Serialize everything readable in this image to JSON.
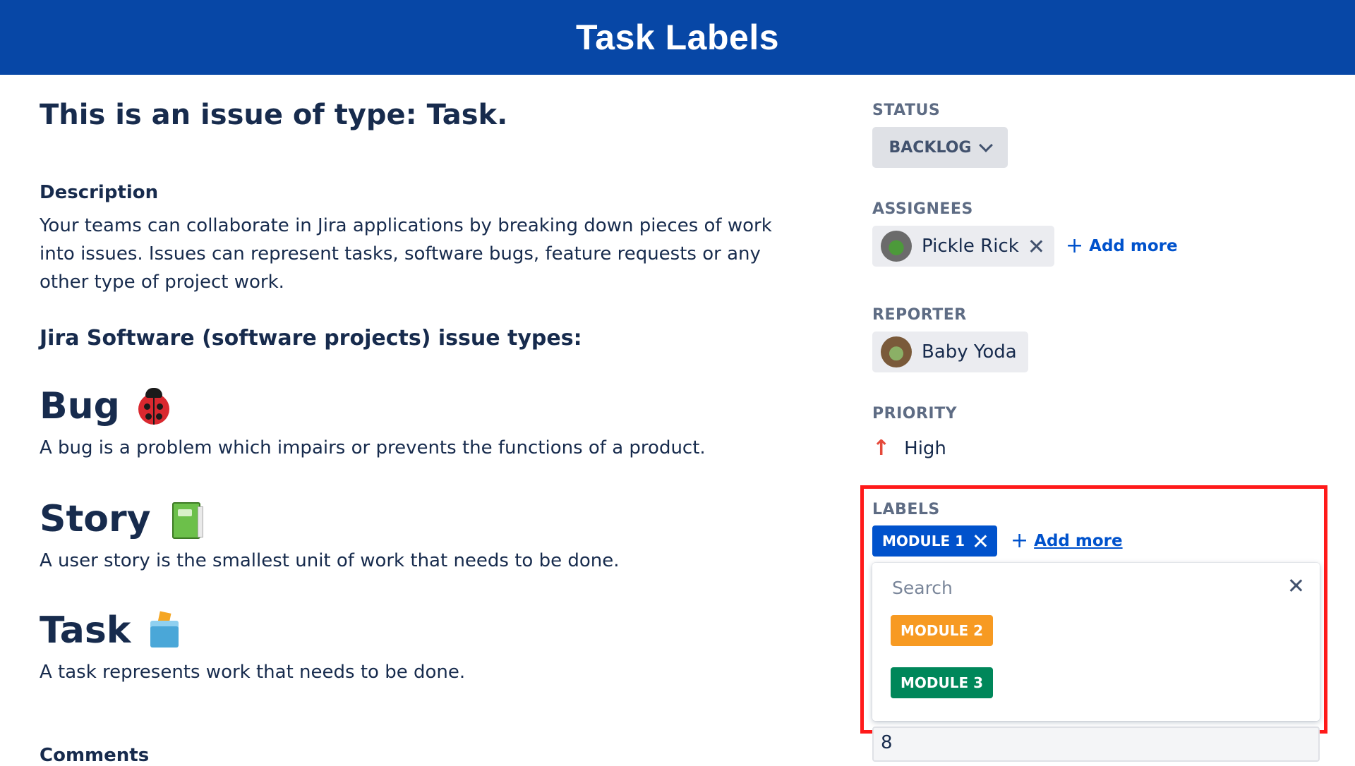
{
  "banner": {
    "title": "Task Labels"
  },
  "issue": {
    "title": "This is an issue of type: Task.",
    "description_heading": "Description",
    "description": "Your teams can collaborate in Jira applications by breaking down pieces of work into issues. Issues can represent tasks, software bugs, feature requests or any other type of project work.",
    "types_heading": "Jira Software (software projects) issue types:",
    "types": [
      {
        "name": "Bug",
        "icon": "ladybug-icon",
        "text": "A bug is a problem which impairs or prevents the functions of a product."
      },
      {
        "name": "Story",
        "icon": "book-icon",
        "text": "A user story is the smallest unit of work that needs to be done."
      },
      {
        "name": "Task",
        "icon": "ballot-box-icon",
        "text": "A task represents work that needs to be done."
      }
    ],
    "comments_heading": "Comments"
  },
  "sidebar": {
    "status": {
      "label": "STATUS",
      "value": "BACKLOG"
    },
    "assignees": {
      "label": "ASSIGNEES",
      "name": "Pickle Rick",
      "add_more": "Add more"
    },
    "reporter": {
      "label": "REPORTER",
      "name": "Baby Yoda"
    },
    "priority": {
      "label": "PRIORITY",
      "value": "High",
      "color": "#e5493a"
    },
    "labels": {
      "label": "LABELS",
      "selected": {
        "text": "MODULE 1",
        "color": "#0052cc"
      },
      "add_more": "Add more",
      "search_placeholder": "Search",
      "options": [
        {
          "text": "MODULE 2",
          "color": "#f79a22"
        },
        {
          "text": "MODULE 3",
          "color": "#00875a"
        }
      ]
    },
    "estimate_value": "8"
  },
  "highlight_color": "#ff1a1a"
}
